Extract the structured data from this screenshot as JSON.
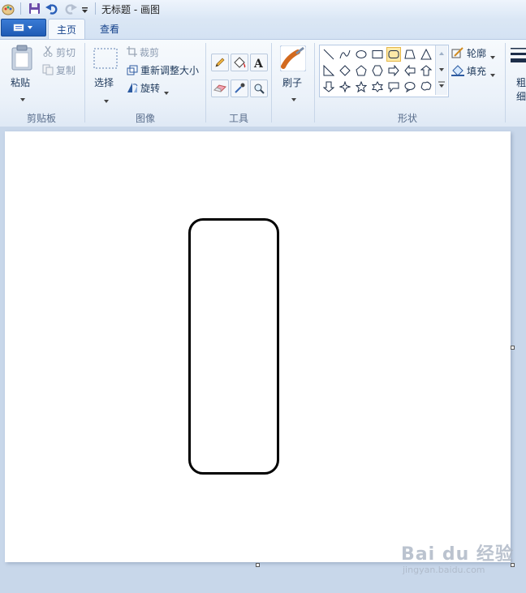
{
  "window": {
    "title": "无标题 - 画图"
  },
  "tabs": [
    {
      "label": "主页",
      "active": true
    },
    {
      "label": "查看",
      "active": false
    }
  ],
  "ribbon": {
    "clipboard": {
      "group_label": "剪贴板",
      "paste": "粘贴",
      "cut": "剪切",
      "copy": "复制"
    },
    "image": {
      "group_label": "图像",
      "select": "选择",
      "crop": "裁剪",
      "resize": "重新调整大小",
      "rotate": "旋转"
    },
    "tools": {
      "group_label": "工具"
    },
    "brushes": {
      "label": "刷子"
    },
    "shapes": {
      "group_label": "形状",
      "outline": "轮廓",
      "fill": "填充"
    },
    "size": {
      "label_top": "粗",
      "label_bottom": "细"
    }
  },
  "watermark": {
    "logo": "Bai du 经验",
    "url": "jingyan.baidu.com"
  },
  "colors": {
    "accent": "#1f5bb5",
    "selection": "#fde9a8",
    "canvas": "#ffffff"
  }
}
